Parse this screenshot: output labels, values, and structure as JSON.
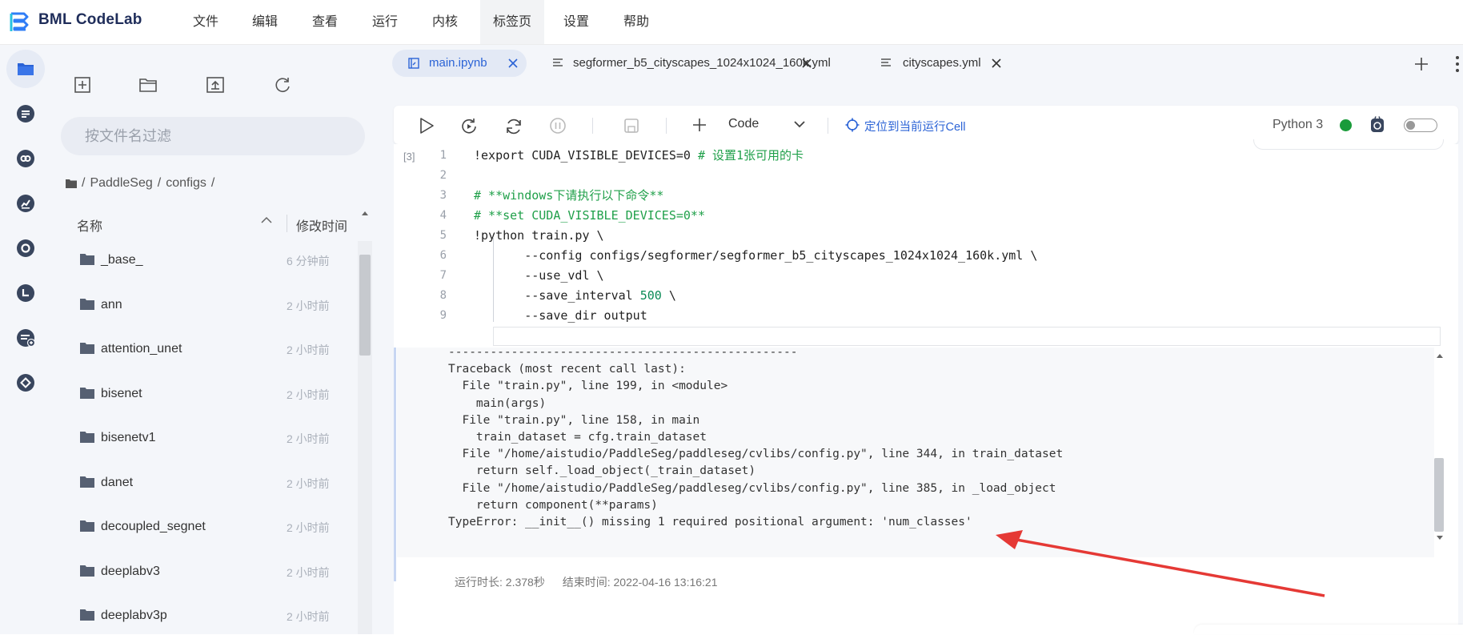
{
  "app": {
    "brand": "BML CodeLab"
  },
  "menu": [
    "文件",
    "编辑",
    "查看",
    "运行",
    "内核",
    "标签页",
    "设置",
    "帮助"
  ],
  "menu_active_index": 5,
  "rail": [
    "folder-icon",
    "list-icon",
    "link-icon",
    "chart-icon",
    "circle-icon",
    "clock-icon",
    "add-list-icon",
    "diamond-icon"
  ],
  "file_panel": {
    "filter_placeholder": "按文件名过滤",
    "breadcrumb": [
      "/",
      "PaddleSeg",
      "/",
      "configs",
      "/"
    ],
    "col_name": "名称",
    "col_time": "修改时间",
    "items": [
      {
        "name": "_base_",
        "time": "6 分钟前"
      },
      {
        "name": "ann",
        "time": "2 小时前"
      },
      {
        "name": "attention_unet",
        "time": "2 小时前"
      },
      {
        "name": "bisenet",
        "time": "2 小时前"
      },
      {
        "name": "bisenetv1",
        "time": "2 小时前"
      },
      {
        "name": "danet",
        "time": "2 小时前"
      },
      {
        "name": "decoupled_segnet",
        "time": "2 小时前"
      },
      {
        "name": "deeplabv3",
        "time": "2 小时前"
      },
      {
        "name": "deeplabv3p",
        "time": "2 小时前"
      }
    ]
  },
  "tabs": [
    {
      "label": "main.ipynb",
      "active": true
    },
    {
      "label": "segformer_b5_cityscapes_1024x1024_160k.yml",
      "active": false
    },
    {
      "label": "cityscapes.yml",
      "active": false
    }
  ],
  "toolbar": {
    "cell_type": "Code",
    "locate": "定位到当前运行Cell",
    "kernel": "Python 3",
    "kernel_status_color": "#1a9b3a"
  },
  "cell": {
    "exec_count": "[3]",
    "lines": [
      {
        "n": "1",
        "text": "!export CUDA_VISIBLE_DEVICES=0 ",
        "comment": "# 设置1张可用的卡"
      },
      {
        "n": "2",
        "text": "",
        "comment": ""
      },
      {
        "n": "3",
        "text": "",
        "comment": "# **windows下请执行以下命令**"
      },
      {
        "n": "4",
        "text": "",
        "comment": "# **set CUDA_VISIBLE_DEVICES=0**"
      },
      {
        "n": "5",
        "text": "!python train.py \\",
        "comment": ""
      },
      {
        "n": "6",
        "text": "       --config configs/segformer/segformer_b5_cityscapes_1024x1024_160k.yml \\",
        "comment": ""
      },
      {
        "n": "7",
        "text": "       --use_vdl \\",
        "comment": ""
      },
      {
        "n": "8",
        "text": "       --save_interval ",
        "num": "500",
        "after": " \\",
        "comment": ""
      },
      {
        "n": "9",
        "text": "       --save_dir output",
        "comment": ""
      }
    ],
    "output": [
      "--------------------------------------------------",
      "Traceback (most recent call last):",
      "  File \"train.py\", line 199, in <module>",
      "    main(args)",
      "  File \"train.py\", line 158, in main",
      "    train_dataset = cfg.train_dataset",
      "  File \"/home/aistudio/PaddleSeg/paddleseg/cvlibs/config.py\", line 344, in train_dataset",
      "    return self._load_object(_train_dataset)",
      "  File \"/home/aistudio/PaddleSeg/paddleseg/cvlibs/config.py\", line 385, in _load_object",
      "    return component(**params)",
      "TypeError: __init__() missing 1 required positional argument: 'num_classes'"
    ],
    "run_duration": "运行时长: 2.378秒",
    "end_time": "结束时间: 2022-04-16 13:16:21"
  },
  "colors": {
    "accent": "#2b63d6",
    "arrow": "#e53935"
  }
}
